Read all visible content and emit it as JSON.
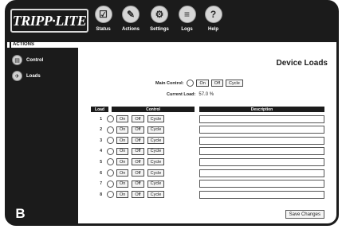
{
  "logo": {
    "text": "TRIPP·LITE"
  },
  "nav": [
    {
      "label": "Status",
      "icon": "status-icon",
      "glyph": "☑"
    },
    {
      "label": "Actions",
      "icon": "actions-icon",
      "glyph": "✎"
    },
    {
      "label": "Settings",
      "icon": "settings-icon",
      "glyph": "⚙"
    },
    {
      "label": "Logs",
      "icon": "logs-icon",
      "glyph": "≡"
    },
    {
      "label": "Help",
      "icon": "help-icon",
      "glyph": "?"
    }
  ],
  "section": {
    "label": "ACTIONS"
  },
  "sidebar": {
    "items": [
      {
        "label": "Control",
        "icon": "control-icon",
        "glyph": "▤"
      },
      {
        "label": "Loads",
        "icon": "loads-icon",
        "glyph": "✈"
      }
    ]
  },
  "main": {
    "title": "Device Loads",
    "main_control_label": "Main Control:",
    "on_label": "On",
    "off_label": "Off",
    "cycle_label": "Cycle",
    "current_load_label": "Current Load:",
    "current_load_value": "57.0 %",
    "table": {
      "headers": {
        "load": "Load",
        "control": "Control",
        "description": "Description"
      },
      "rows": [
        {
          "num": "1",
          "description": ""
        },
        {
          "num": "2",
          "description": ""
        },
        {
          "num": "3",
          "description": ""
        },
        {
          "num": "4",
          "description": ""
        },
        {
          "num": "5",
          "description": ""
        },
        {
          "num": "6",
          "description": ""
        },
        {
          "num": "7",
          "description": ""
        },
        {
          "num": "8",
          "description": ""
        }
      ]
    },
    "save_label": "Save Changes"
  },
  "badge": {
    "text": "B"
  }
}
